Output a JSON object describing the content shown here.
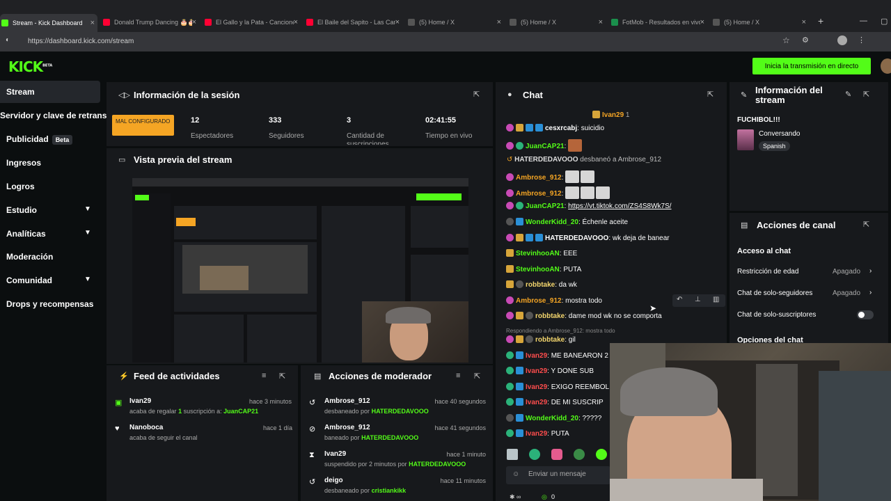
{
  "browser": {
    "tabs": [
      {
        "label": "Stream - Kick Dashboard",
        "color": "#53fc18",
        "active": true
      },
      {
        "label": "Donald Trump Dancing 🎂🎂",
        "color": "#ff0033"
      },
      {
        "label": "El Gallo y la Pata - Canciones...",
        "color": "#ff0033"
      },
      {
        "label": "El Baile del Sapito - Las Can...",
        "color": "#ff0033"
      },
      {
        "label": "(5) Home / X",
        "color": "#555"
      },
      {
        "label": "(5) Home / X",
        "color": "#555"
      },
      {
        "label": "FotMob - Resultados en vivo",
        "color": "#1a8f4c"
      },
      {
        "label": "(5) Home / X",
        "color": "#555"
      }
    ],
    "url": "https://dashboard.kick.com/stream"
  },
  "header": {
    "logo": "KICK",
    "logo_sup": "BETA",
    "golive_label": "Inicia la transmisión en directo"
  },
  "sidebar": {
    "items": [
      {
        "label": "Stream"
      },
      {
        "label": "Servidor y clave de retransm"
      },
      {
        "label": "Publicidad",
        "badge": "Beta"
      },
      {
        "label": "Ingresos"
      },
      {
        "label": "Logros"
      },
      {
        "label": "Estudio"
      },
      {
        "label": "Analíticas"
      },
      {
        "label": "Moderación"
      },
      {
        "label": "Comunidad"
      },
      {
        "label": "Drops y recompensas"
      }
    ]
  },
  "session": {
    "title": "Información de la sesión",
    "status": "MAL CONFIGURADO",
    "stats": [
      {
        "value": "12",
        "label": "Espectadores"
      },
      {
        "value": "333",
        "label": "Seguidores"
      },
      {
        "value": "3",
        "label": "Cantidad de suscripciones"
      },
      {
        "value": "02:41:55",
        "label": "Tiempo en vivo"
      }
    ]
  },
  "preview": {
    "title": "Vista previa del stream"
  },
  "feed": {
    "title": "Feed de actividades",
    "items": [
      {
        "name": "Ivan29",
        "time": "hace 3 minutos",
        "text": "acaba de regalar",
        "count": "1",
        "mid": "suscripción a:",
        "target": "JuanCAP21"
      },
      {
        "name": "Nanoboca",
        "time": "hace 1 día",
        "text": "acaba de seguir el canal"
      }
    ]
  },
  "modactions": {
    "title": "Acciones de moderador",
    "items": [
      {
        "name": "Ambrose_912",
        "time": "hace 40 segundos",
        "text": "desbaneado por",
        "by": "HATERDEDAVOOO"
      },
      {
        "name": "Ambrose_912",
        "time": "hace 41 segundos",
        "text": "baneado por",
        "by": "HATERDEDAVOOO"
      },
      {
        "name": "Ivan29",
        "time": "hace 1 minuto",
        "text": "suspendido por 2 minutos por",
        "by": "HATERDEDAVOOO"
      },
      {
        "name": "deigo",
        "time": "hace 11 minutos",
        "text": "desbaneado por",
        "by": "cristiankikk"
      }
    ]
  },
  "chat": {
    "title": "Chat",
    "pinned_user": "Ivan29",
    "pinned_count": "1",
    "input_placeholder": "Enviar un mensaje",
    "footer_count": "0",
    "system": {
      "user": "HATERDEDAVOOO",
      "text": "desbaneó a",
      "target": "Ambrose_912"
    },
    "reply_note": "Respondiendo a Ambrose_912: mostra todo",
    "messages": [
      {
        "user": "cesxrcabj",
        "color": "#ffffff",
        "text": "suicidio"
      },
      {
        "user": "JuanCAP21",
        "color": "#53fc18",
        "text": ""
      },
      {
        "user": "Ambrose_912",
        "color": "#f5a524",
        "text": ""
      },
      {
        "user": "Ambrose_912",
        "color": "#f5a524",
        "text": ""
      },
      {
        "user": "JuanCAP21",
        "color": "#53fc18",
        "text": "https://vt.tiktok.com/ZS4S8Wk7S/"
      },
      {
        "user": "WonderKidd_20",
        "color": "#53fc18",
        "text": "Échenle aceite"
      },
      {
        "user": "HATERDEDAVOOO",
        "color": "#ffffff",
        "text": "wk deja de banear"
      },
      {
        "user": "StevinhooAN",
        "color": "#53fc18",
        "text": "EEE"
      },
      {
        "user": "StevinhooAN",
        "color": "#53fc18",
        "text": "PUTA"
      },
      {
        "user": "robbtake",
        "color": "#f5d76e",
        "text": "da wk"
      },
      {
        "user": "Ambrose_912",
        "color": "#f5a524",
        "text": "mostra todo"
      },
      {
        "user": "robbtake",
        "color": "#f5d76e",
        "text": "dame mod wk no se comporta"
      },
      {
        "user": "robbtake",
        "color": "#f5d76e",
        "text": "gil"
      },
      {
        "user": "Ivan29",
        "color": "#ff4d4d",
        "text": "ME BANEARON 2"
      },
      {
        "user": "Ivan29",
        "color": "#ff4d4d",
        "text": "Y DONE SUB"
      },
      {
        "user": "Ivan29",
        "color": "#ff4d4d",
        "text": "EXIGO REEMBOL"
      },
      {
        "user": "Ivan29",
        "color": "#ff4d4d",
        "text": "DE MI SUSCRIP"
      },
      {
        "user": "WonderKidd_20",
        "color": "#53fc18",
        "text": "?????"
      },
      {
        "user": "Ivan29",
        "color": "#ff4d4d",
        "text": "PUTA"
      }
    ]
  },
  "streaminfo": {
    "title": "Información del stream",
    "stream_title": "FUCHIBOL!!!",
    "category": "Conversando",
    "language": "Spanish"
  },
  "channel": {
    "title": "Acciones de canal",
    "section": "Acceso al chat",
    "rows": [
      {
        "label": "Restricción de edad",
        "value": "Apagado"
      },
      {
        "label": "Chat de solo-seguidores",
        "value": "Apagado"
      },
      {
        "label": "Chat de solo-suscriptores",
        "value": ""
      }
    ],
    "section2": "Opciones del chat"
  }
}
